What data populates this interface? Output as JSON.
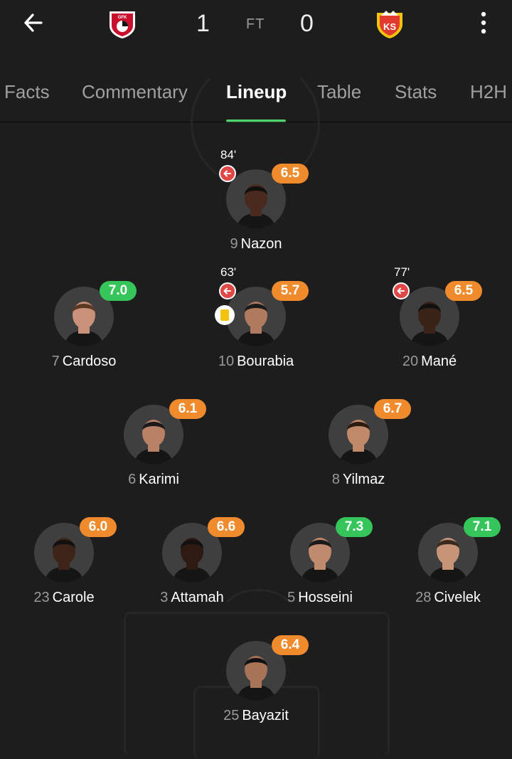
{
  "match": {
    "home_score": "1",
    "status": "FT",
    "away_score": "0",
    "home_crest_text": "GFK",
    "away_crest_text": "KS"
  },
  "tabs": [
    "Facts",
    "Commentary",
    "Lineup",
    "Table",
    "Stats",
    "H2H"
  ],
  "active_tab": "Lineup",
  "colors": {
    "background": "#1d1d1d",
    "accent": "#4fd26b",
    "rating_orange": "#ef8b2c",
    "rating_green": "#35c55a",
    "sub_red": "#e04848",
    "yellow_card": "#f2c40d"
  },
  "players": [
    {
      "number": "9",
      "name": "Nazon",
      "rating": "6.5",
      "rating_color": "orange",
      "sub_minute": "84'",
      "subbed_off": true
    },
    {
      "number": "7",
      "name": "Cardoso",
      "rating": "7.0",
      "rating_color": "green"
    },
    {
      "number": "10",
      "name": "Bourabia",
      "rating": "5.7",
      "rating_color": "orange",
      "sub_minute": "63'",
      "subbed_off": true,
      "yellow_card": true
    },
    {
      "number": "20",
      "name": "Mané",
      "rating": "6.5",
      "rating_color": "orange",
      "sub_minute": "77'",
      "subbed_off": true
    },
    {
      "number": "6",
      "name": "Karimi",
      "rating": "6.1",
      "rating_color": "orange"
    },
    {
      "number": "8",
      "name": "Yilmaz",
      "rating": "6.7",
      "rating_color": "orange"
    },
    {
      "number": "23",
      "name": "Carole",
      "rating": "6.0",
      "rating_color": "orange"
    },
    {
      "number": "3",
      "name": "Attamah",
      "rating": "6.6",
      "rating_color": "orange"
    },
    {
      "number": "5",
      "name": "Hosseini",
      "rating": "7.3",
      "rating_color": "green"
    },
    {
      "number": "28",
      "name": "Civelek",
      "rating": "7.1",
      "rating_color": "green"
    },
    {
      "number": "25",
      "name": "Bayazit",
      "rating": "6.4",
      "rating_color": "orange"
    }
  ]
}
